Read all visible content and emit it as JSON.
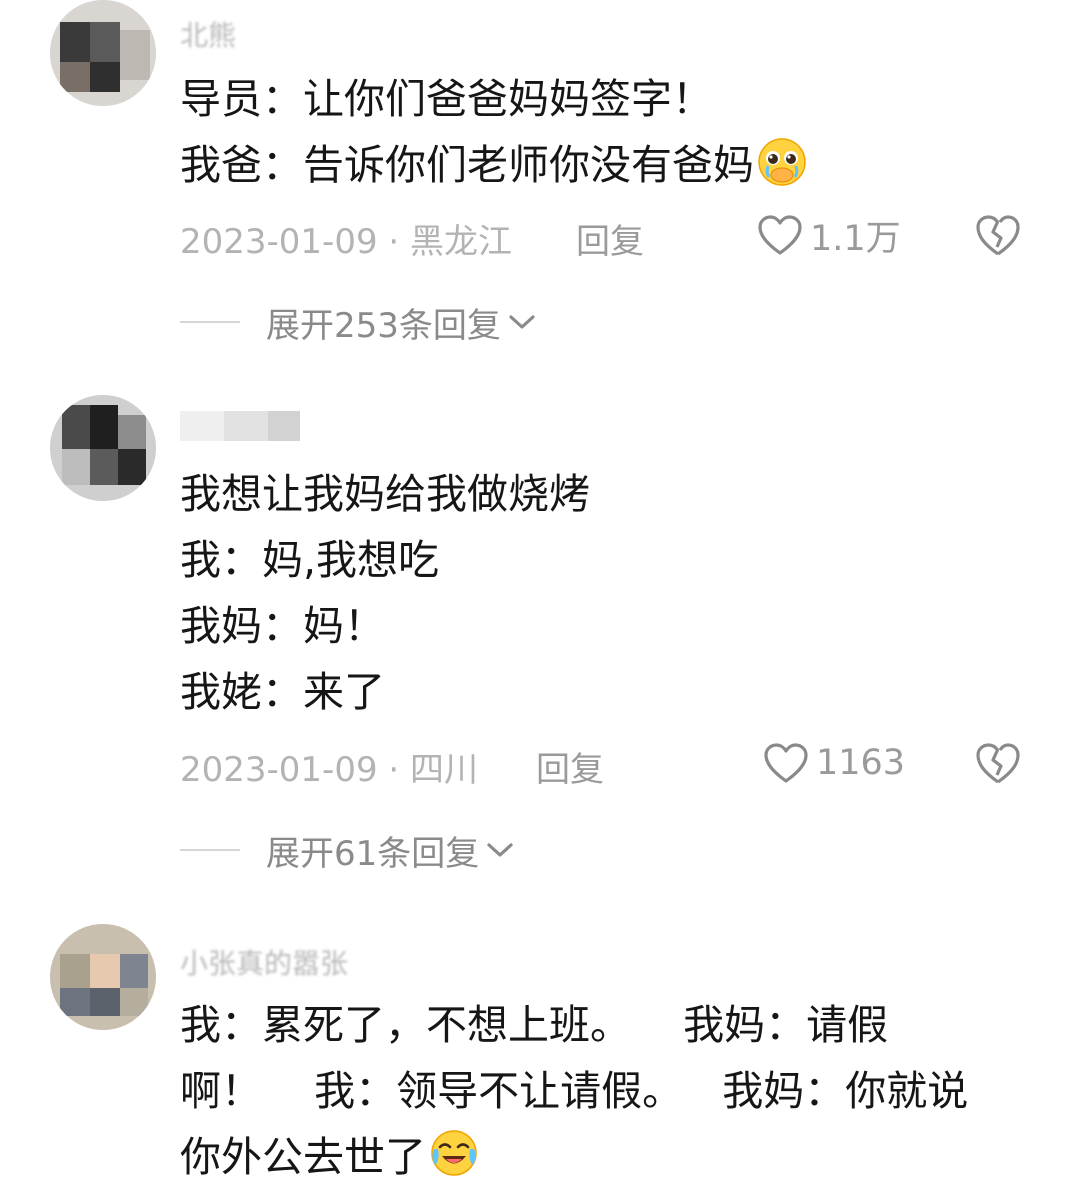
{
  "comments": [
    {
      "username": "北熊",
      "lines": [
        "导员：让你们爸爸妈妈签字！",
        "我爸：告诉你们老师你没有爸妈"
      ],
      "emoji": "pleading-crying-face-icon",
      "date_location": "2023-01-09 · 黑龙江",
      "reply_label": "回复",
      "like_count": "1.1万",
      "expand_label": "展开253条回复"
    },
    {
      "username": "",
      "lines": [
        "我想让我妈给我做烧烤",
        "我：妈,我想吃",
        "我妈：妈！",
        "我姥：来了"
      ],
      "date_location": "2023-01-09 · 四川",
      "reply_label": "回复",
      "like_count": "1163",
      "expand_label": "展开61条回复"
    },
    {
      "username": "小张真的嚣张",
      "lines": [
        "我：累死了，不想上班。    我妈：请假",
        "啊！    我：领导不让请假。   我妈：你就说",
        "你外公去世了"
      ],
      "emoji": "tears-of-joy-face-icon"
    }
  ],
  "colors": {
    "text": "#161616",
    "meta": "#b3b3b3",
    "secondary": "#9a9a9a",
    "divider": "#d6d6d6"
  }
}
